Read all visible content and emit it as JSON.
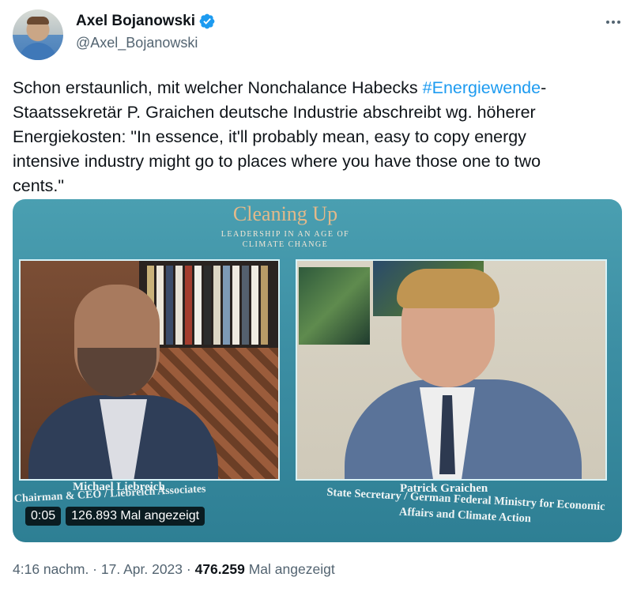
{
  "author": {
    "name": "Axel Bojanowski",
    "handle": "@Axel_Bojanowski",
    "verified_color": "#1d9bf0"
  },
  "more_icon": "more-icon",
  "tweet": {
    "text_before": "Schon erstaunlich, mit welcher Nonchalance Habecks ",
    "hashtag": "#Energiewende",
    "text_after": "-\nStaatssekretär P. Graichen deutsche Industrie abschreibt wg. höherer\nEnergiekosten: \"In essence, it'll probably mean, easy to copy energy\nintensive industry might go to places where you have those one to two\ncents.\""
  },
  "video": {
    "title": "Cleaning Up",
    "subtitle": "LEADERSHIP IN AN AGE OF CLIMATE CHANGE",
    "left_name": "Michael Liebreich",
    "left_role": "Chairman & CEO / Liebreich Associates",
    "right_name": "Patrick Graichen",
    "right_role": "State Secretary / German Federal Ministry for Economic Affairs and Climate Action",
    "timestamp": "0:05",
    "views": "126.893 Mal angezeigt"
  },
  "footer": {
    "time": "4:16 nachm.",
    "separator": " · ",
    "date": "17. Apr. 2023",
    "view_count": "476.259",
    "view_label": " Mal angezeigt"
  }
}
